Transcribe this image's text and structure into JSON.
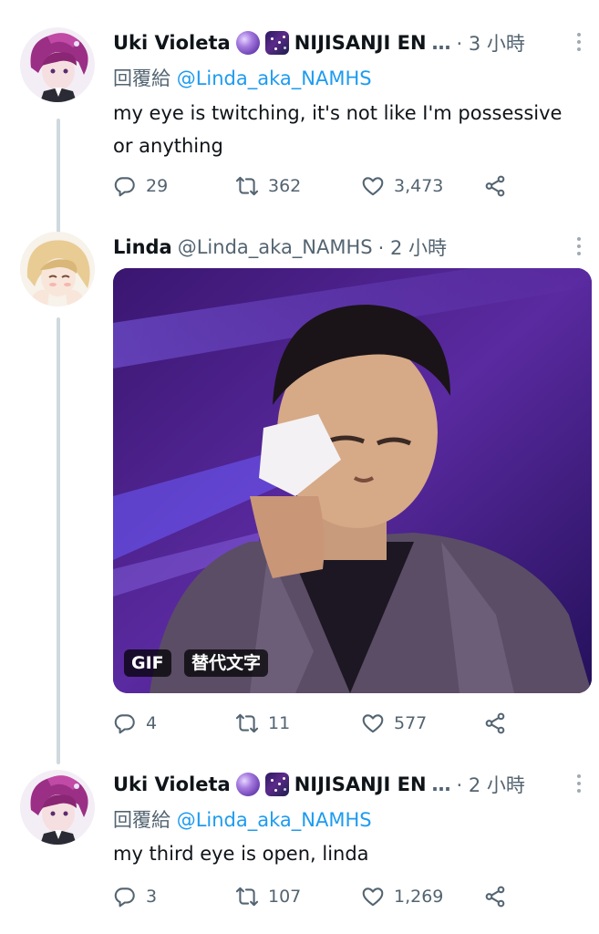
{
  "tweets": [
    {
      "name": "Uki Violeta",
      "org": "NIJISANJI EN",
      "ellipsis": "…",
      "time": "· 3 小時",
      "reply_label": "回覆給",
      "reply_handle": "@Linda_aka_NAMHS",
      "text": "my eye is twitching, it's not like I'm possessive or anything",
      "replies": "29",
      "retweets": "362",
      "likes": "3,473"
    },
    {
      "name": "Linda",
      "handle": "@Linda_aka_NAMHS",
      "time": "· 2 小時",
      "media": {
        "gif_label": "GIF",
        "alt_label": "替代文字"
      },
      "replies": "4",
      "retweets": "11",
      "likes": "577"
    },
    {
      "name": "Uki Violeta",
      "org": "NIJISANJI EN",
      "ellipsis": "…",
      "time": "· 2 小時",
      "reply_label": "回覆給",
      "reply_handle": "@Linda_aka_NAMHS",
      "text": "my third eye is open, linda",
      "replies": "3",
      "retweets": "107",
      "likes": "1,269"
    }
  ],
  "icons": {
    "reply": "reply-icon",
    "retweet": "retweet-icon",
    "like": "heart-icon",
    "share": "share-icon",
    "more": "more-icon",
    "emoji_1": "crystal-ball-emoji",
    "emoji_2": "milky-way-emoji"
  },
  "colors": {
    "link": "#1d9bf0",
    "secondary": "#536471",
    "thread_line": "#cfd9de"
  }
}
